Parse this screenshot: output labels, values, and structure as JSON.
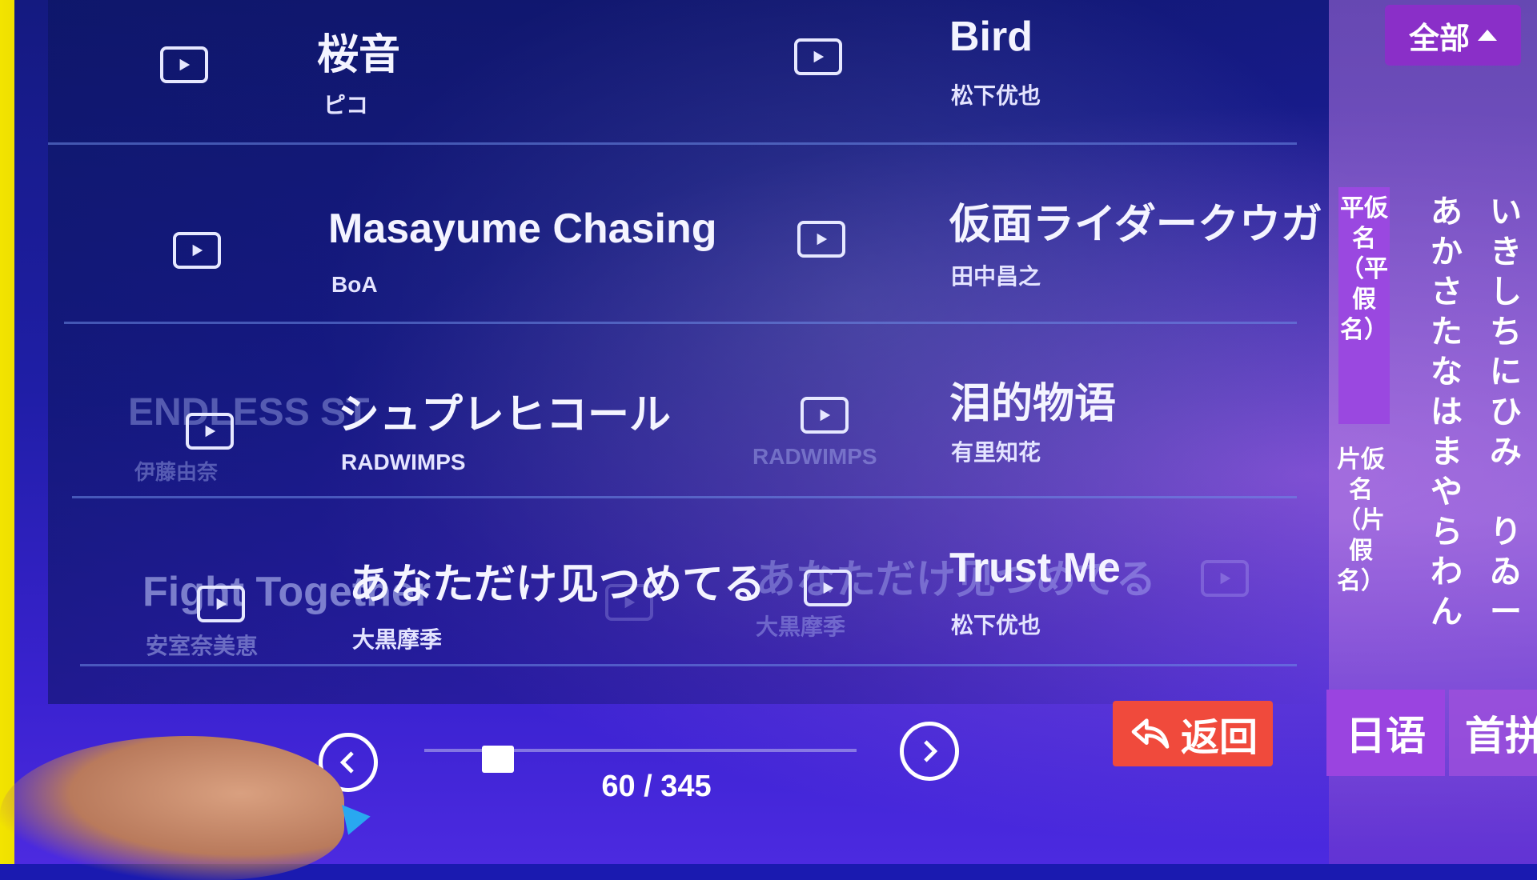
{
  "top_filter": {
    "label": "全部"
  },
  "songs": [
    {
      "title": "桜音",
      "artist": "ピコ"
    },
    {
      "title": "Bird",
      "artist": "松下优也"
    },
    {
      "title": "Masayume Chasing",
      "artist": "BoA"
    },
    {
      "title": "仮面ライダークウガ",
      "artist": "田中昌之"
    },
    {
      "title": "シュプレヒコール",
      "artist": "RADWIMPS"
    },
    {
      "title": "泪的物语",
      "artist": "有里知花"
    },
    {
      "title": "あなただけ见つめてる",
      "artist": "大黒摩季"
    },
    {
      "title": "Trust Me",
      "artist": "松下优也"
    }
  ],
  "ghost_items": {
    "left_title": "Fight Together",
    "left_artist": "安室奈美恵",
    "faded_mid_title": "あなただけ见つめてる",
    "faded_mid_artist": "大黒摩季",
    "faded_endless": "ENDLESS ST",
    "faded_endless_artist": "伊藤由奈",
    "faded_radwimps": "RADWIMPS"
  },
  "kana_tabs": {
    "hiragana": "平仮名（平假名）",
    "katakana": "片仮名（片假名）"
  },
  "kana_columns": [
    [
      "あ",
      "か",
      "さ",
      "た",
      "な",
      "は",
      "ま",
      "や",
      "ら",
      "わ",
      "ん"
    ],
    [
      "い",
      "き",
      "し",
      "ち",
      "に",
      "ひ",
      "み",
      "",
      "り",
      "ゐ",
      "ー"
    ]
  ],
  "pagination": {
    "current": 60,
    "total": 345,
    "text": "60 / 345",
    "progress_fraction": 0.17
  },
  "back_button": {
    "label": "返回"
  },
  "language_tabs": [
    {
      "label": "日语",
      "active": true
    },
    {
      "label": "首拼",
      "active": false
    }
  ],
  "colors": {
    "accent_purple": "#9a44e0",
    "back_red": "#f04a3c"
  }
}
